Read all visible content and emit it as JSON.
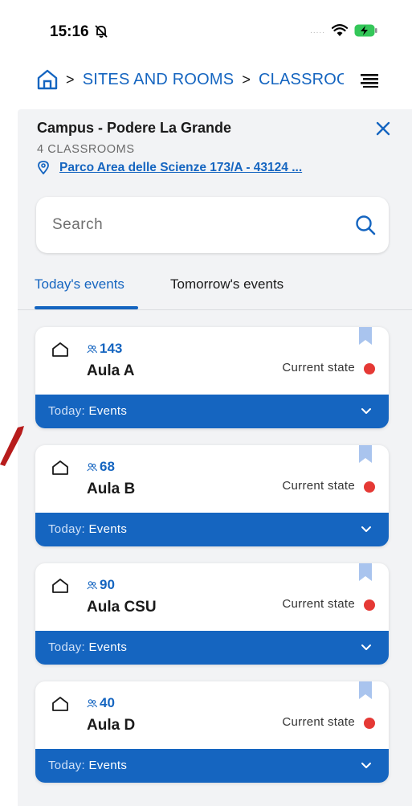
{
  "status_bar": {
    "time": "15:16",
    "signal": "....."
  },
  "breadcrumb": {
    "items": [
      {
        "label": "SITES AND ROOMS"
      },
      {
        "label": "CLASSROOMS"
      }
    ],
    "separator": ">"
  },
  "campus": {
    "title": "Campus - Podere La Grande",
    "room_count": "4 CLASSROOMS",
    "address": "Parco Area delle Scienze 173/A - 43124 ..."
  },
  "search": {
    "placeholder": "Search"
  },
  "tabs": {
    "today": "Today's events",
    "tomorrow": "Tomorrow's events"
  },
  "cards": [
    {
      "capacity": "143",
      "name": "Aula A",
      "state_label": "Current state",
      "events_prefix": "Today:",
      "events_label": "Events"
    },
    {
      "capacity": "68",
      "name": "Aula B",
      "state_label": "Current state",
      "events_prefix": "Today:",
      "events_label": "Events"
    },
    {
      "capacity": "90",
      "name": "Aula CSU",
      "state_label": "Current state",
      "events_prefix": "Today:",
      "events_label": "Events"
    },
    {
      "capacity": "40",
      "name": "Aula D",
      "state_label": "Current state",
      "events_prefix": "Today:",
      "events_label": "Events"
    }
  ],
  "colors": {
    "accent": "#1565c0",
    "panel_bg": "#f2f3f5",
    "state_dot": "#e53935",
    "bookmark": "#a9c4ee",
    "arrow": "#b71c1c"
  },
  "icons": {
    "home": "home-icon",
    "menu": "menu-icon",
    "close": "close-icon",
    "pin": "map-pin-icon",
    "search": "search-icon",
    "room": "room-icon",
    "people": "people-icon",
    "bookmark": "bookmark-icon",
    "chevron": "chevron-down-icon"
  }
}
